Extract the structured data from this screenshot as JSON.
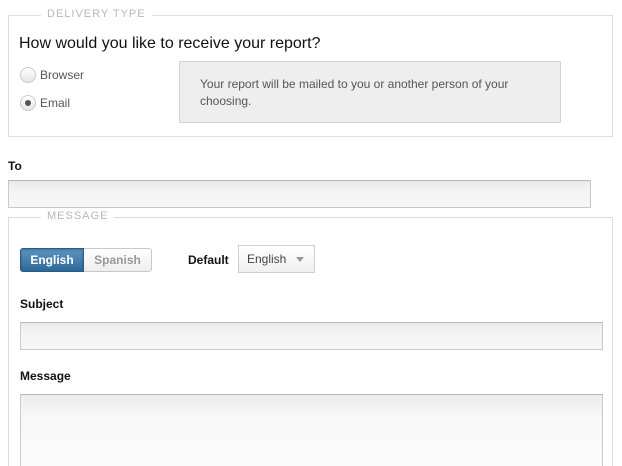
{
  "delivery": {
    "legend": "DELIVERY TYPE",
    "question": "How would you like to receive your report?",
    "options": [
      {
        "label": "Browser",
        "checked": false
      },
      {
        "label": "Email",
        "checked": true
      }
    ],
    "info_text": "Your report will be mailed to you or another person of your choosing."
  },
  "to": {
    "label": "To",
    "value": ""
  },
  "message": {
    "legend": "MESSAGE",
    "languages": [
      {
        "label": "English",
        "active": true
      },
      {
        "label": "Spanish",
        "active": false
      }
    ],
    "default_label": "Default",
    "default_value": "English",
    "subject_label": "Subject",
    "subject_value": "",
    "message_label": "Message",
    "message_value": ""
  },
  "colors": {
    "active_button": "#3a76a6",
    "info_box_bg": "#eeeeee",
    "legend_text": "#b8b8b8"
  }
}
